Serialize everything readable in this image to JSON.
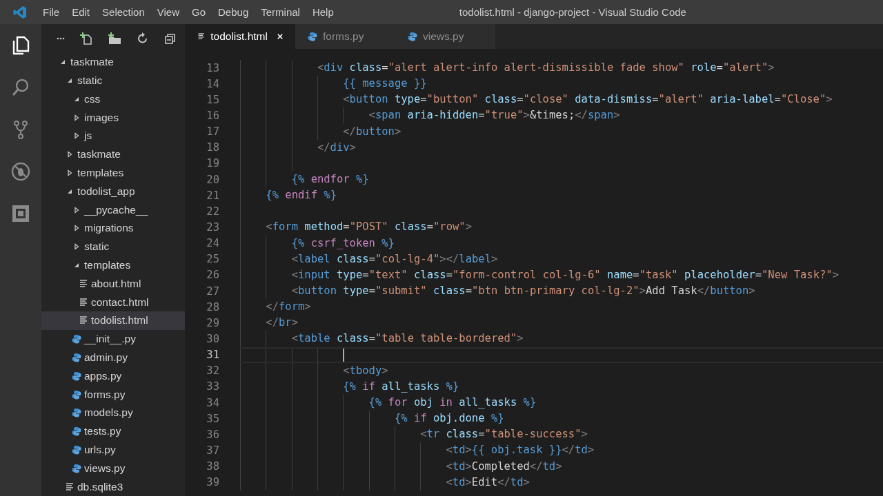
{
  "window": {
    "title": "todolist.html - django-project - Visual Studio Code"
  },
  "menu": [
    "File",
    "Edit",
    "Selection",
    "View",
    "Go",
    "Debug",
    "Terminal",
    "Help"
  ],
  "activity_bar": [
    {
      "kind": "files",
      "selected": true
    },
    {
      "kind": "search",
      "selected": false
    },
    {
      "kind": "source-control",
      "selected": false
    },
    {
      "kind": "debug",
      "selected": false
    },
    {
      "kind": "extensions",
      "selected": false
    }
  ],
  "explorer": {
    "items": [
      {
        "label": "taskmate",
        "kind": "folder",
        "expanded": true,
        "selected": false,
        "children": [
          {
            "label": "static",
            "kind": "folder",
            "expanded": true,
            "selected": false,
            "children": [
              {
                "label": "css",
                "kind": "folder",
                "expanded": true,
                "selected": false
              },
              {
                "label": "images",
                "kind": "folder",
                "expanded": false,
                "selected": false
              },
              {
                "label": "js",
                "kind": "folder",
                "expanded": false,
                "selected": false
              }
            ]
          },
          {
            "label": "taskmate",
            "kind": "folder",
            "expanded": false,
            "selected": false
          },
          {
            "label": "templates",
            "kind": "folder",
            "expanded": false,
            "selected": false
          },
          {
            "label": "todolist_app",
            "kind": "folder",
            "expanded": true,
            "selected": false,
            "children": [
              {
                "label": "__pycache__",
                "kind": "folder",
                "expanded": false,
                "selected": false
              },
              {
                "label": "migrations",
                "kind": "folder",
                "expanded": false,
                "selected": false
              },
              {
                "label": "static",
                "kind": "folder",
                "expanded": false,
                "selected": false
              },
              {
                "label": "templates",
                "kind": "folder",
                "expanded": true,
                "selected": false,
                "children": [
                  {
                    "label": "about.html",
                    "kind": "document",
                    "selected": false
                  },
                  {
                    "label": "contact.html",
                    "kind": "document",
                    "selected": false
                  },
                  {
                    "label": "todolist.html",
                    "kind": "document",
                    "selected": true
                  }
                ]
              },
              {
                "label": "__init__.py",
                "kind": "python",
                "selected": false
              },
              {
                "label": "admin.py",
                "kind": "python",
                "selected": false
              },
              {
                "label": "apps.py",
                "kind": "python",
                "selected": false
              },
              {
                "label": "forms.py",
                "kind": "python",
                "selected": false
              },
              {
                "label": "models.py",
                "kind": "python",
                "selected": false
              },
              {
                "label": "tests.py",
                "kind": "python",
                "selected": false
              },
              {
                "label": "urls.py",
                "kind": "python",
                "selected": false
              },
              {
                "label": "views.py",
                "kind": "python",
                "selected": false
              }
            ]
          },
          {
            "label": "db.sqlite3",
            "kind": "document",
            "selected": false
          }
        ]
      }
    ]
  },
  "tabs": [
    {
      "label": "todolist.html",
      "kind": "document",
      "selected": true
    },
    {
      "label": "forms.py",
      "kind": "python",
      "selected": false
    },
    {
      "label": "views.py",
      "kind": "python",
      "selected": false
    }
  ],
  "editor": {
    "lines": [
      {
        "number": "13",
        "current": false,
        "tokens": [
          {
            "kind": "p",
            "text": "            <"
          },
          {
            "kind": "tag",
            "text": "div"
          },
          {
            "kind": "attr",
            "text": " class"
          },
          {
            "kind": "eq",
            "text": "="
          },
          {
            "kind": "str",
            "text": "\"alert alert-info alert-dismissible fade show\""
          },
          {
            "kind": "attr",
            "text": " role"
          },
          {
            "kind": "eq",
            "text": "="
          },
          {
            "kind": "str",
            "text": "\"alert\""
          },
          {
            "kind": "p",
            "text": ">"
          }
        ]
      },
      {
        "number": "14",
        "current": false,
        "tokens": [
          {
            "kind": "tpl",
            "text": "                {{ message }}"
          }
        ]
      },
      {
        "number": "15",
        "current": false,
        "tokens": [
          {
            "kind": "p",
            "text": "                <"
          },
          {
            "kind": "tag",
            "text": "button"
          },
          {
            "kind": "attr",
            "text": " type"
          },
          {
            "kind": "eq",
            "text": "="
          },
          {
            "kind": "str",
            "text": "\"button\""
          },
          {
            "kind": "attr",
            "text": " class"
          },
          {
            "kind": "eq",
            "text": "="
          },
          {
            "kind": "str",
            "text": "\"close\""
          },
          {
            "kind": "attr",
            "text": " data-dismiss"
          },
          {
            "kind": "eq",
            "text": "="
          },
          {
            "kind": "str",
            "text": "\"alert\""
          },
          {
            "kind": "attr",
            "text": " aria-label"
          },
          {
            "kind": "eq",
            "text": "="
          },
          {
            "kind": "str",
            "text": "\"Close\""
          },
          {
            "kind": "p",
            "text": ">"
          }
        ]
      },
      {
        "number": "16",
        "current": false,
        "tokens": [
          {
            "kind": "p",
            "text": "                    <"
          },
          {
            "kind": "tag",
            "text": "span"
          },
          {
            "kind": "attr",
            "text": " aria-hidden"
          },
          {
            "kind": "eq",
            "text": "="
          },
          {
            "kind": "str",
            "text": "\"true\""
          },
          {
            "kind": "p",
            "text": ">"
          },
          {
            "kind": "text",
            "text": "&times;"
          },
          {
            "kind": "p",
            "text": "</"
          },
          {
            "kind": "tag",
            "text": "span"
          },
          {
            "kind": "p",
            "text": ">"
          }
        ]
      },
      {
        "number": "17",
        "current": false,
        "tokens": [
          {
            "kind": "p",
            "text": "                </"
          },
          {
            "kind": "tag",
            "text": "button"
          },
          {
            "kind": "p",
            "text": ">"
          }
        ]
      },
      {
        "number": "18",
        "current": false,
        "tokens": [
          {
            "kind": "p",
            "text": "            </"
          },
          {
            "kind": "tag",
            "text": "div"
          },
          {
            "kind": "p",
            "text": ">"
          }
        ]
      },
      {
        "number": "19",
        "current": false
      },
      {
        "number": "20",
        "current": false,
        "tokens": [
          {
            "kind": "tpl",
            "text": "        {%"
          },
          {
            "kind": "kw",
            "text": " endfor "
          },
          {
            "kind": "tpl",
            "text": "%}"
          }
        ]
      },
      {
        "number": "21",
        "current": false,
        "tokens": [
          {
            "kind": "tpl",
            "text": "    {%"
          },
          {
            "kind": "kw",
            "text": " endif "
          },
          {
            "kind": "tpl",
            "text": "%}"
          }
        ]
      },
      {
        "number": "22",
        "current": false
      },
      {
        "number": "23",
        "current": false,
        "tokens": [
          {
            "kind": "p",
            "text": "    <"
          },
          {
            "kind": "tag",
            "text": "form"
          },
          {
            "kind": "attr",
            "text": " method"
          },
          {
            "kind": "eq",
            "text": "="
          },
          {
            "kind": "str",
            "text": "\"POST\""
          },
          {
            "kind": "attr",
            "text": " class"
          },
          {
            "kind": "eq",
            "text": "="
          },
          {
            "kind": "str",
            "text": "\"row\""
          },
          {
            "kind": "p",
            "text": ">"
          }
        ]
      },
      {
        "number": "24",
        "current": false,
        "tokens": [
          {
            "kind": "tpl",
            "text": "        {%"
          },
          {
            "kind": "kw",
            "text": " csrf_token "
          },
          {
            "kind": "tpl",
            "text": "%}"
          }
        ]
      },
      {
        "number": "25",
        "current": false,
        "tokens": [
          {
            "kind": "p",
            "text": "        <"
          },
          {
            "kind": "tag",
            "text": "label"
          },
          {
            "kind": "attr",
            "text": " class"
          },
          {
            "kind": "eq",
            "text": "="
          },
          {
            "kind": "str",
            "text": "\"col-lg-4\""
          },
          {
            "kind": "p",
            "text": "></"
          },
          {
            "kind": "tag",
            "text": "label"
          },
          {
            "kind": "p",
            "text": ">"
          }
        ]
      },
      {
        "number": "26",
        "current": false,
        "tokens": [
          {
            "kind": "p",
            "text": "        <"
          },
          {
            "kind": "tag",
            "text": "input"
          },
          {
            "kind": "attr",
            "text": " type"
          },
          {
            "kind": "eq",
            "text": "="
          },
          {
            "kind": "str",
            "text": "\"text\""
          },
          {
            "kind": "attr",
            "text": " class"
          },
          {
            "kind": "eq",
            "text": "="
          },
          {
            "kind": "str",
            "text": "\"form-control col-lg-6\""
          },
          {
            "kind": "attr",
            "text": " name"
          },
          {
            "kind": "eq",
            "text": "="
          },
          {
            "kind": "str",
            "text": "\"task\""
          },
          {
            "kind": "attr",
            "text": " placeholder"
          },
          {
            "kind": "eq",
            "text": "="
          },
          {
            "kind": "str",
            "text": "\"New Task?\""
          },
          {
            "kind": "p",
            "text": ">"
          }
        ]
      },
      {
        "number": "27",
        "current": false,
        "tokens": [
          {
            "kind": "p",
            "text": "        <"
          },
          {
            "kind": "tag",
            "text": "button"
          },
          {
            "kind": "attr",
            "text": " type"
          },
          {
            "kind": "eq",
            "text": "="
          },
          {
            "kind": "str",
            "text": "\"submit\""
          },
          {
            "kind": "attr",
            "text": " class"
          },
          {
            "kind": "eq",
            "text": "="
          },
          {
            "kind": "str",
            "text": "\"btn btn-primary col-lg-2\""
          },
          {
            "kind": "p",
            "text": ">"
          },
          {
            "kind": "text",
            "text": "Add Task"
          },
          {
            "kind": "p",
            "text": "</"
          },
          {
            "kind": "tag",
            "text": "button"
          },
          {
            "kind": "p",
            "text": ">"
          }
        ]
      },
      {
        "number": "28",
        "current": false,
        "tokens": [
          {
            "kind": "p",
            "text": "    </"
          },
          {
            "kind": "tag",
            "text": "form"
          },
          {
            "kind": "p",
            "text": ">"
          }
        ]
      },
      {
        "number": "29",
        "current": false,
        "tokens": [
          {
            "kind": "p",
            "text": "    </"
          },
          {
            "kind": "tag",
            "text": "br"
          },
          {
            "kind": "p",
            "text": ">"
          }
        ]
      },
      {
        "number": "30",
        "current": false,
        "tokens": [
          {
            "kind": "p",
            "text": "        <"
          },
          {
            "kind": "tag",
            "text": "table"
          },
          {
            "kind": "attr",
            "text": " class"
          },
          {
            "kind": "eq",
            "text": "="
          },
          {
            "kind": "str",
            "text": "\"table table-bordered\""
          },
          {
            "kind": "p",
            "text": ">"
          }
        ]
      },
      {
        "number": "31",
        "current": true
      },
      {
        "number": "32",
        "current": false,
        "tokens": [
          {
            "kind": "p",
            "text": "                <"
          },
          {
            "kind": "tag",
            "text": "tbody"
          },
          {
            "kind": "p",
            "text": ">"
          }
        ]
      },
      {
        "number": "33",
        "current": false,
        "tokens": [
          {
            "kind": "tpl",
            "text": "                {%"
          },
          {
            "kind": "kw",
            "text": " if "
          },
          {
            "kind": "var",
            "text": "all_tasks "
          },
          {
            "kind": "tpl",
            "text": "%}"
          }
        ]
      },
      {
        "number": "34",
        "current": false,
        "tokens": [
          {
            "kind": "tpl",
            "text": "                    {%"
          },
          {
            "kind": "kw",
            "text": " for "
          },
          {
            "kind": "var",
            "text": "obj "
          },
          {
            "kind": "kw",
            "text": "in "
          },
          {
            "kind": "var",
            "text": "all_tasks "
          },
          {
            "kind": "tpl",
            "text": "%}"
          }
        ]
      },
      {
        "number": "35",
        "current": false,
        "tokens": [
          {
            "kind": "tpl",
            "text": "                        {%"
          },
          {
            "kind": "kw",
            "text": " if "
          },
          {
            "kind": "var",
            "text": "obj.done "
          },
          {
            "kind": "tpl",
            "text": "%}"
          }
        ]
      },
      {
        "number": "36",
        "current": false,
        "tokens": [
          {
            "kind": "p",
            "text": "                            <"
          },
          {
            "kind": "tag",
            "text": "tr"
          },
          {
            "kind": "attr",
            "text": " class"
          },
          {
            "kind": "eq",
            "text": "="
          },
          {
            "kind": "str",
            "text": "\"table-success\""
          },
          {
            "kind": "p",
            "text": ">"
          }
        ]
      },
      {
        "number": "37",
        "current": false,
        "tokens": [
          {
            "kind": "p",
            "text": "                                <"
          },
          {
            "kind": "tag",
            "text": "td"
          },
          {
            "kind": "p",
            "text": ">"
          },
          {
            "kind": "tpl",
            "text": "{{ obj.task }}"
          },
          {
            "kind": "p",
            "text": "</"
          },
          {
            "kind": "tag",
            "text": "td"
          },
          {
            "kind": "p",
            "text": ">"
          }
        ]
      },
      {
        "number": "38",
        "current": false,
        "tokens": [
          {
            "kind": "p",
            "text": "                                <"
          },
          {
            "kind": "tag",
            "text": "td"
          },
          {
            "kind": "p",
            "text": ">"
          },
          {
            "kind": "text",
            "text": "Completed"
          },
          {
            "kind": "p",
            "text": "</"
          },
          {
            "kind": "tag",
            "text": "td"
          },
          {
            "kind": "p",
            "text": ">"
          }
        ]
      },
      {
        "number": "39",
        "current": false,
        "tokens": [
          {
            "kind": "p",
            "text": "                                <"
          },
          {
            "kind": "tag",
            "text": "td"
          },
          {
            "kind": "p",
            "text": ">"
          },
          {
            "kind": "text",
            "text": "Edit"
          },
          {
            "kind": "p",
            "text": "</"
          },
          {
            "kind": "tag",
            "text": "td"
          },
          {
            "kind": "p",
            "text": ">"
          }
        ]
      }
    ]
  }
}
